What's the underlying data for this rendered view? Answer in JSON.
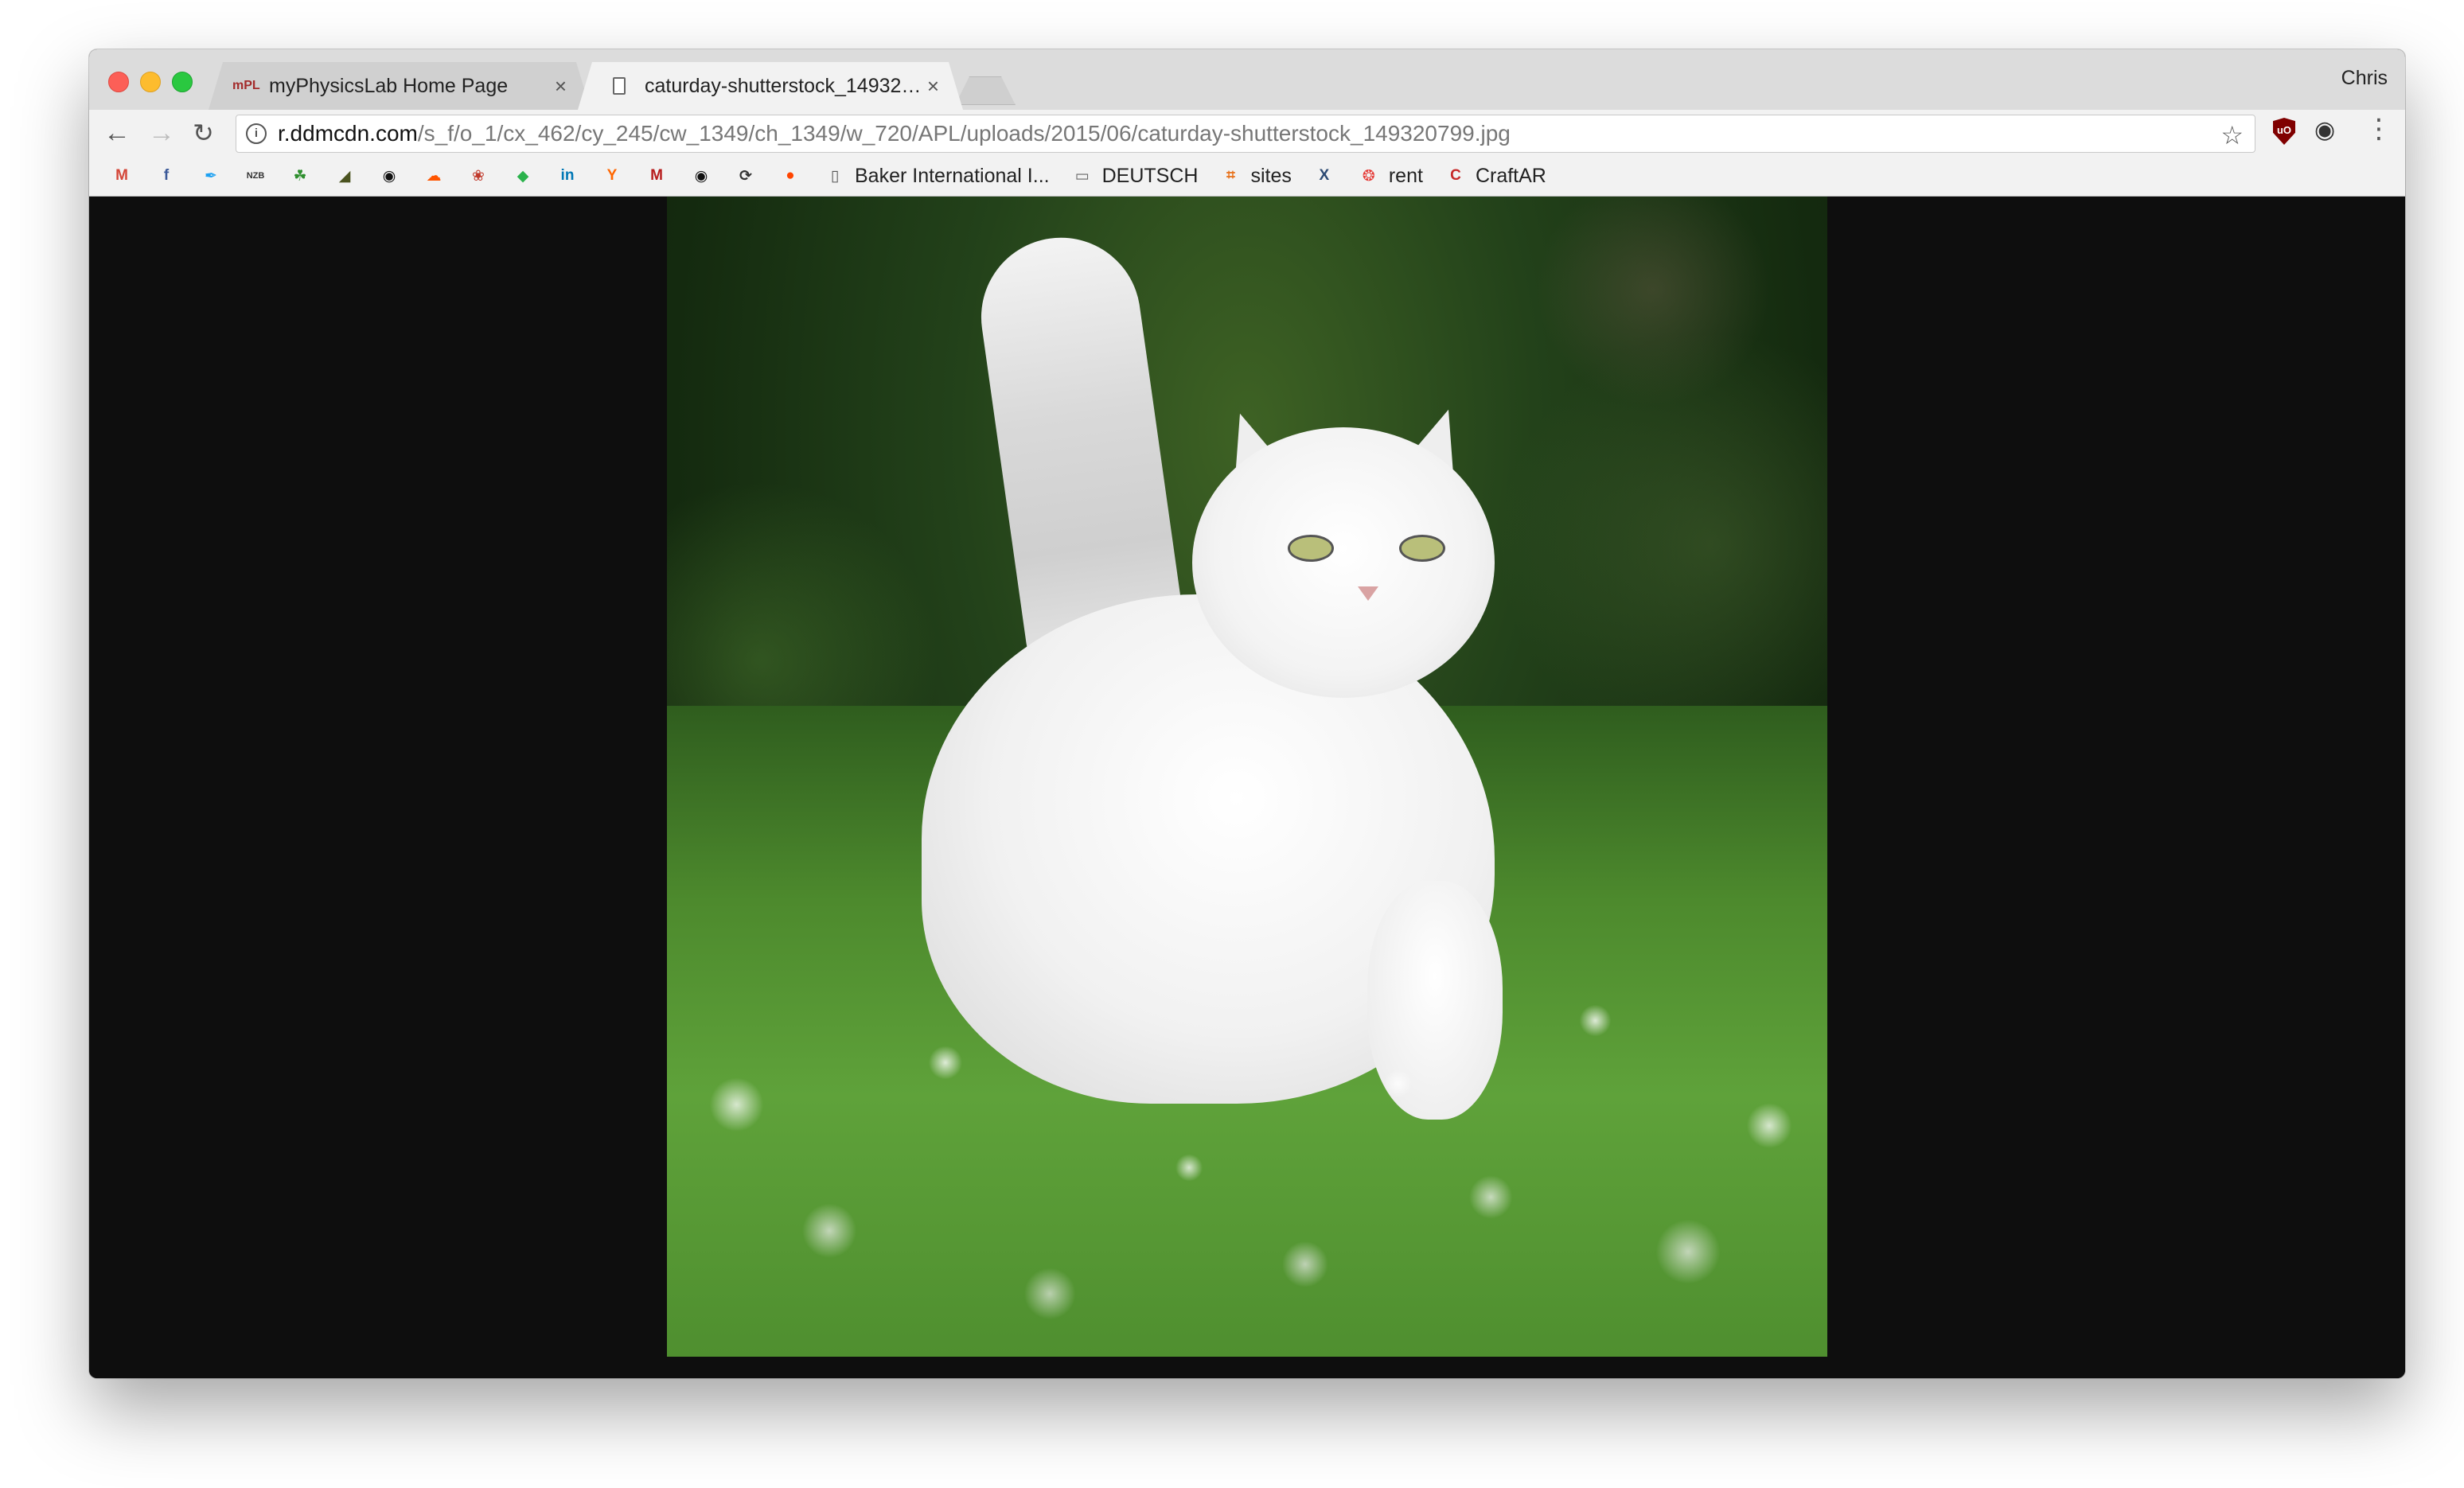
{
  "window": {
    "profile_name": "Chris"
  },
  "tabs": [
    {
      "favicon_text": "mPL",
      "title": "myPhysicsLab Home Page",
      "active": false
    },
    {
      "favicon_text": "",
      "title": "caturday-shutterstock_14932…",
      "active": true
    }
  ],
  "toolbar": {
    "url_host": "r.ddmcdn.com",
    "url_path": "/s_f/o_1/cx_462/cy_245/cw_1349/ch_1349/w_720/APL/uploads/2015/06/caturday-shutterstock_149320799.jpg",
    "info_glyph": "i",
    "star_glyph": "☆"
  },
  "bookmarks": [
    {
      "icon": "gmail-icon",
      "glyph": "M",
      "color": "#d44638",
      "label": ""
    },
    {
      "icon": "facebook-icon",
      "glyph": "f",
      "color": "#3b5998",
      "label": ""
    },
    {
      "icon": "twitter-icon",
      "glyph": "✒",
      "color": "#1da1f2",
      "label": ""
    },
    {
      "icon": "nzbget-icon",
      "glyph": "NZB",
      "color": "#333333",
      "label": ""
    },
    {
      "icon": "turtle-icon",
      "glyph": "☘",
      "color": "#2f8f2f",
      "label": ""
    },
    {
      "icon": "sketch-icon",
      "glyph": "◢",
      "color": "#4b5320",
      "label": ""
    },
    {
      "icon": "github-icon",
      "glyph": "◉",
      "color": "#111111",
      "label": ""
    },
    {
      "icon": "soundcloud-icon",
      "glyph": "☁",
      "color": "#ff5500",
      "label": ""
    },
    {
      "icon": "brain-icon",
      "glyph": "❀",
      "color": "#c0392b",
      "label": ""
    },
    {
      "icon": "feedly-icon",
      "glyph": "◆",
      "color": "#2bb24c",
      "label": ""
    },
    {
      "icon": "linkedin-icon",
      "glyph": "in",
      "color": "#0077b5",
      "label": ""
    },
    {
      "icon": "hackernews-icon",
      "glyph": "Y",
      "color": "#ff6600",
      "label": ""
    },
    {
      "icon": "imdb-icon",
      "glyph": "M",
      "color": "#b71c1c",
      "label": ""
    },
    {
      "icon": "github-icon",
      "glyph": "◉",
      "color": "#111111",
      "label": ""
    },
    {
      "icon": "refresh-icon",
      "glyph": "⟳",
      "color": "#333333",
      "label": ""
    },
    {
      "icon": "reddit-icon",
      "glyph": "●",
      "color": "#ff4500",
      "label": ""
    },
    {
      "icon": "document-icon",
      "glyph": "▯",
      "color": "#555555",
      "label": "Baker International I..."
    },
    {
      "icon": "folder-icon",
      "glyph": "▭",
      "color": "#666666",
      "label": "DEUTSCH"
    },
    {
      "icon": "sites-icon",
      "glyph": "⌗",
      "color": "#e8711a",
      "label": "sites"
    },
    {
      "icon": "x-icon",
      "glyph": "X",
      "color": "#2c4a73",
      "label": ""
    },
    {
      "icon": "rent-icon",
      "glyph": "❂",
      "color": "#e53935",
      "label": "rent"
    },
    {
      "icon": "craftar-icon",
      "glyph": "C",
      "color": "#c62828",
      "label": "CraftAR"
    }
  ],
  "image": {
    "alt": ""
  }
}
